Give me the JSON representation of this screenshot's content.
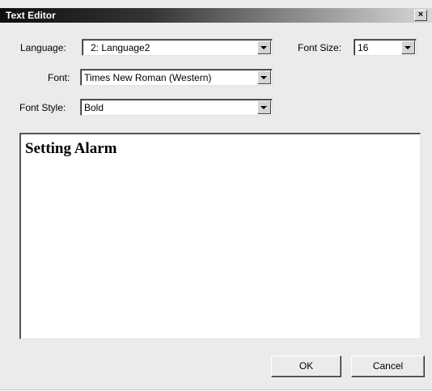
{
  "window": {
    "title": "Text Editor",
    "close_glyph": "×"
  },
  "form": {
    "language_label": "Language:",
    "language_value": "2: Language2",
    "font_size_label": "Font Size:",
    "font_size_value": "16",
    "font_label": "Font:",
    "font_value": "Times New Roman (Western)",
    "font_style_label": "Font Style:",
    "font_style_value": "Bold"
  },
  "editor": {
    "text": "Setting Alarm"
  },
  "buttons": {
    "ok_label": "OK",
    "cancel_label": "Cancel"
  },
  "icons": {
    "dropdown": "chevron-down-icon",
    "close": "close-icon"
  }
}
